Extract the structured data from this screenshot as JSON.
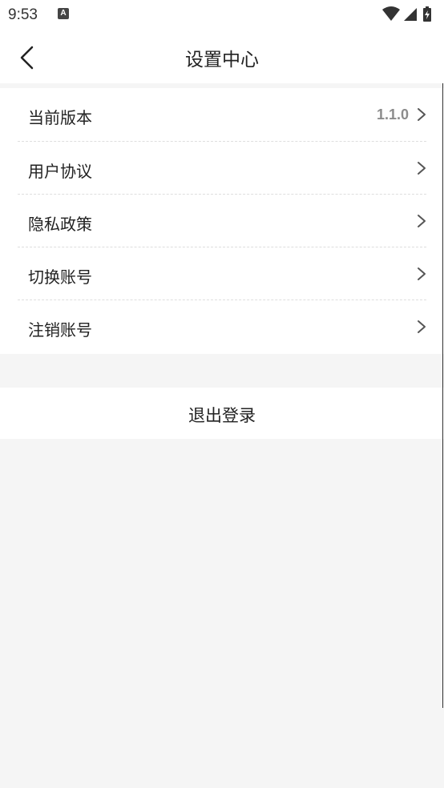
{
  "status_bar": {
    "time": "9:53",
    "app_icon_letter": "A"
  },
  "header": {
    "title": "设置中心"
  },
  "menu": {
    "items": [
      {
        "label": "当前版本",
        "value": "1.1.0"
      },
      {
        "label": "用户协议"
      },
      {
        "label": "隐私政策"
      },
      {
        "label": "切换账号"
      },
      {
        "label": "注销账号"
      }
    ]
  },
  "logout": {
    "label": "退出登录"
  },
  "colors": {
    "background": "#f5f5f5",
    "card": "#ffffff",
    "text": "#222222",
    "secondary_text": "#8c8c8c",
    "divider": "#dedede"
  }
}
